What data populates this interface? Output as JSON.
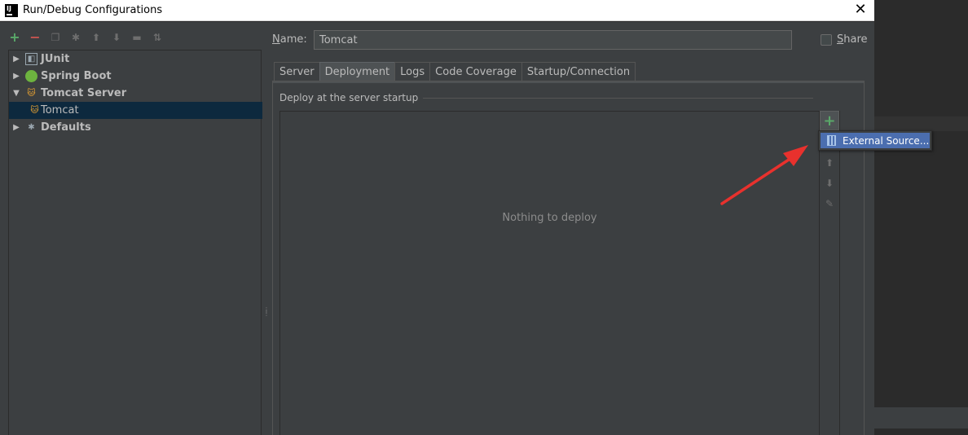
{
  "window": {
    "title": "Run/Debug Configurations",
    "logo_text": "IJ",
    "close_glyph": "✕"
  },
  "toolbar": {
    "icons": [
      "add-icon",
      "remove-icon",
      "copy-icon",
      "edit-defaults-icon",
      "move-up-icon",
      "move-down-icon",
      "folder-icon",
      "sort-icon"
    ]
  },
  "tree": {
    "items": [
      {
        "label": "JUnit",
        "expanded": false
      },
      {
        "label": "Spring Boot",
        "expanded": false
      },
      {
        "label": "Tomcat Server",
        "expanded": true
      },
      {
        "label": "Tomcat",
        "selected": true
      },
      {
        "label": "Defaults",
        "expanded": false
      }
    ]
  },
  "form": {
    "name_label_underlined": "N",
    "name_label_rest": "ame:",
    "name_value": "Tomcat",
    "share_underlined": "S",
    "share_rest": "hare"
  },
  "tabs": [
    {
      "label": "Server",
      "active": false
    },
    {
      "label": "Deployment",
      "active": true
    },
    {
      "label": "Logs",
      "active": false
    },
    {
      "label": "Code Coverage",
      "active": false
    },
    {
      "label": "Startup/Connection",
      "active": false
    }
  ],
  "deployment": {
    "group_label": "Deploy at the server startup",
    "empty_text": "Nothing to deploy",
    "popup_item": "External Source...",
    "side_icons": [
      "add-icon",
      "move-up-icon",
      "move-down-icon",
      "edit-icon"
    ]
  },
  "colors": {
    "accent_green": "#59a869",
    "remove_red": "#c75450",
    "selection": "#4b6eaf",
    "annotation_arrow": "#e8312d"
  }
}
